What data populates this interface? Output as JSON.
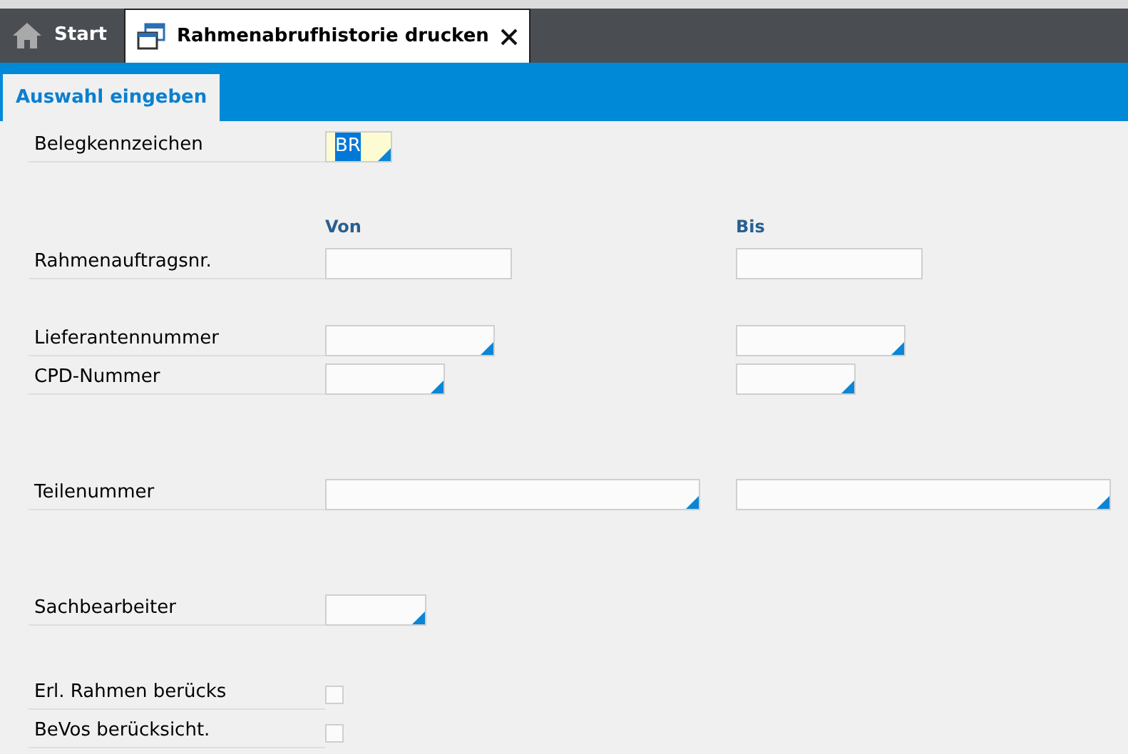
{
  "tabs": [
    {
      "label": "Start",
      "kind": "home",
      "selected": false,
      "closable": false
    },
    {
      "label": "Rahmenabrufhistorie drucken",
      "kind": "document",
      "selected": true,
      "closable": true
    }
  ],
  "subtabs": [
    {
      "label": "Auswahl eingeben",
      "selected": true
    }
  ],
  "form": {
    "header_from": "Von",
    "header_to": "Bis",
    "rows": [
      {
        "kind": "single",
        "label": "Belegkennzeichen",
        "value": "BR",
        "value_selected": true,
        "lookup": true,
        "highlighted": true
      },
      {
        "kind": "range",
        "label": "Rahmenauftragsnr.",
        "lookup": false
      },
      {
        "kind": "range",
        "label": "Lieferantennummer",
        "lookup": true
      },
      {
        "kind": "range",
        "label": "CPD-Nummer",
        "lookup": true
      },
      {
        "kind": "range",
        "label": "Teilenummer",
        "lookup": true
      },
      {
        "kind": "single",
        "label": "Sachbearbeiter",
        "lookup": true,
        "highlighted": false
      },
      {
        "kind": "checkbox",
        "label": "Erl. Rahmen berücks",
        "checked": false
      },
      {
        "kind": "checkbox",
        "label": "BeVos berücksicht.",
        "checked": false
      }
    ]
  }
}
